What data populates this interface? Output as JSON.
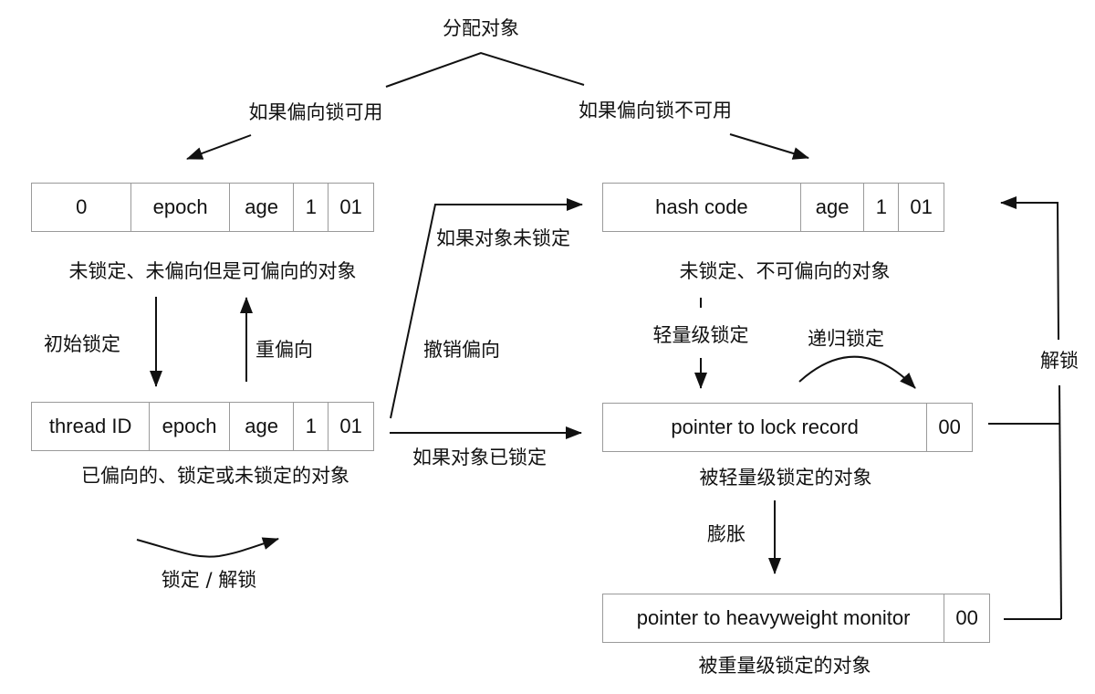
{
  "title": "分配对象",
  "branches": {
    "biased_available": "如果偏向锁可用",
    "biased_unavailable": "如果偏向锁不可用"
  },
  "states": {
    "anonymously_biased": {
      "fields": [
        "0",
        "epoch",
        "age",
        "1",
        "01"
      ],
      "caption": "未锁定、未偏向但是可偏向的对象"
    },
    "unlocked_unbiasable": {
      "fields": [
        "hash code",
        "age",
        "1",
        "01"
      ],
      "caption": "未锁定、不可偏向的对象"
    },
    "biased": {
      "fields": [
        "thread ID",
        "epoch",
        "age",
        "1",
        "01"
      ],
      "caption": "已偏向的、锁定或未锁定的对象"
    },
    "lightweight_locked": {
      "fields": [
        "pointer to lock record",
        "00"
      ],
      "caption": "被轻量级锁定的对象"
    },
    "heavyweight_locked": {
      "fields": [
        "pointer to heavyweight monitor",
        "00"
      ],
      "caption": "被重量级锁定的对象"
    }
  },
  "transitions": {
    "initial_lock": "初始锁定",
    "rebias": "重偏向",
    "revoke_bias": "撤销偏向",
    "if_unlocked": "如果对象未锁定",
    "if_locked": "如果对象已锁定",
    "lightweight_lock": "轻量级锁定",
    "recursive_lock": "递归锁定",
    "inflate": "膨胀",
    "unlock": "解锁",
    "lock_unlock": "锁定 / 解锁"
  }
}
